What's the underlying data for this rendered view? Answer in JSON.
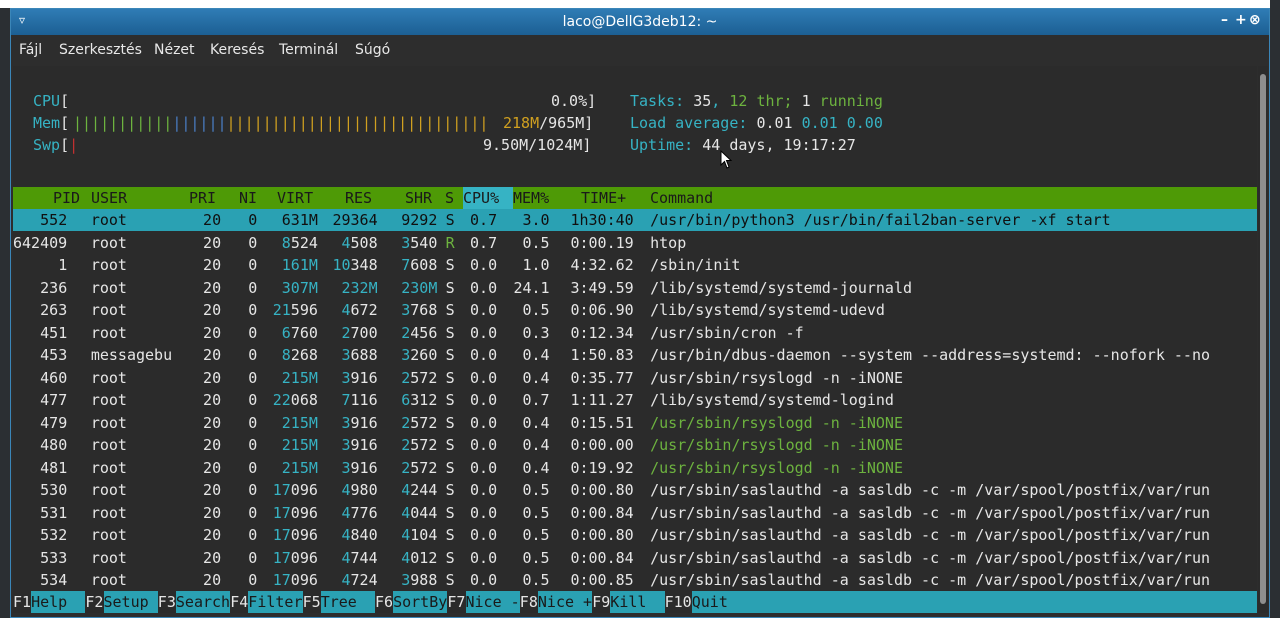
{
  "window": {
    "title": "laco@DellG3deb12: ~",
    "menu_glyph": "▿",
    "ctrl_min": "–",
    "ctrl_max": "+",
    "ctrl_close": "⊗"
  },
  "menu": [
    "Fájl",
    "Szerkesztés",
    "Nézet",
    "Keresés",
    "Terminál",
    "Súgó"
  ],
  "meters": {
    "cpu_label": "CPU",
    "cpu_value": "0.0%]",
    "mem_label": "Mem",
    "mem_used": "218M",
    "mem_total": "/965M]",
    "swp_label": "Swp",
    "swp_value": "9.50M/1024M]"
  },
  "stats": {
    "tasks_label": "Tasks:",
    "tasks": "35",
    "thr": "12",
    "thr_label": "thr;",
    "running": "1",
    "running_label": "running",
    "load_label": "Load average:",
    "load1": "0.01",
    "load5": "0.01",
    "load15": "0.00",
    "uptime_label": "Uptime:",
    "uptime": "44 days, 19:17:27"
  },
  "columns": [
    "PID",
    "USER",
    "PRI",
    "NI",
    "VIRT",
    "RES",
    "SHR",
    "S",
    "CPU%",
    "MEM%",
    "TIME+",
    "Command"
  ],
  "processes": [
    {
      "pid": "552",
      "user": "root",
      "pri": "20",
      "ni": "0",
      "virt": "631M",
      "res": "29364",
      "shr": "9292",
      "s": "S",
      "cpu": "0.7",
      "mem": "3.0",
      "time": "1h30:40",
      "cmd": "/usr/bin/python3 /usr/bin/fail2ban-server -xf start"
    },
    {
      "pid": "642409",
      "user": "root",
      "pri": "20",
      "ni": "0",
      "virt": "8524",
      "res": "4508",
      "shr": "3540",
      "s": "R",
      "cpu": "0.7",
      "mem": "0.5",
      "time": "0:00.19",
      "cmd": "htop"
    },
    {
      "pid": "1",
      "user": "root",
      "pri": "20",
      "ni": "0",
      "virt": "161M",
      "res": "10348",
      "shr": "7608",
      "s": "S",
      "cpu": "0.0",
      "mem": "1.0",
      "time": "4:32.62",
      "cmd": "/sbin/init"
    },
    {
      "pid": "236",
      "user": "root",
      "pri": "20",
      "ni": "0",
      "virt": "307M",
      "res": "232M",
      "shr": "230M",
      "s": "S",
      "cpu": "0.0",
      "mem": "24.1",
      "time": "3:49.59",
      "cmd": "/lib/systemd/systemd-journald"
    },
    {
      "pid": "263",
      "user": "root",
      "pri": "20",
      "ni": "0",
      "virt": "21596",
      "res": "4672",
      "shr": "3768",
      "s": "S",
      "cpu": "0.0",
      "mem": "0.5",
      "time": "0:06.90",
      "cmd": "/lib/systemd/systemd-udevd"
    },
    {
      "pid": "451",
      "user": "root",
      "pri": "20",
      "ni": "0",
      "virt": "6760",
      "res": "2700",
      "shr": "2456",
      "s": "S",
      "cpu": "0.0",
      "mem": "0.3",
      "time": "0:12.34",
      "cmd": "/usr/sbin/cron -f"
    },
    {
      "pid": "453",
      "user": "messagebu",
      "pri": "20",
      "ni": "0",
      "virt": "8268",
      "res": "3688",
      "shr": "3260",
      "s": "S",
      "cpu": "0.0",
      "mem": "0.4",
      "time": "1:50.83",
      "cmd": "/usr/bin/dbus-daemon --system --address=systemd: --nofork --no"
    },
    {
      "pid": "460",
      "user": "root",
      "pri": "20",
      "ni": "0",
      "virt": "215M",
      "res": "3916",
      "shr": "2572",
      "s": "S",
      "cpu": "0.0",
      "mem": "0.4",
      "time": "0:35.77",
      "cmd": "/usr/sbin/rsyslogd -n -iNONE"
    },
    {
      "pid": "477",
      "user": "root",
      "pri": "20",
      "ni": "0",
      "virt": "22068",
      "res": "7116",
      "shr": "6312",
      "s": "S",
      "cpu": "0.0",
      "mem": "0.7",
      "time": "1:11.27",
      "cmd": "/lib/systemd/systemd-logind"
    },
    {
      "pid": "479",
      "user": "root",
      "pri": "20",
      "ni": "0",
      "virt": "215M",
      "res": "3916",
      "shr": "2572",
      "s": "S",
      "cpu": "0.0",
      "mem": "0.4",
      "time": "0:15.51",
      "cmd": "/usr/sbin/rsyslogd -n -iNONE",
      "thread": true
    },
    {
      "pid": "480",
      "user": "root",
      "pri": "20",
      "ni": "0",
      "virt": "215M",
      "res": "3916",
      "shr": "2572",
      "s": "S",
      "cpu": "0.0",
      "mem": "0.4",
      "time": "0:00.00",
      "cmd": "/usr/sbin/rsyslogd -n -iNONE",
      "thread": true
    },
    {
      "pid": "481",
      "user": "root",
      "pri": "20",
      "ni": "0",
      "virt": "215M",
      "res": "3916",
      "shr": "2572",
      "s": "S",
      "cpu": "0.0",
      "mem": "0.4",
      "time": "0:19.92",
      "cmd": "/usr/sbin/rsyslogd -n -iNONE",
      "thread": true
    },
    {
      "pid": "530",
      "user": "root",
      "pri": "20",
      "ni": "0",
      "virt": "17096",
      "res": "4980",
      "shr": "4244",
      "s": "S",
      "cpu": "0.0",
      "mem": "0.5",
      "time": "0:00.80",
      "cmd": "/usr/sbin/saslauthd -a sasldb -c -m /var/spool/postfix/var/run"
    },
    {
      "pid": "531",
      "user": "root",
      "pri": "20",
      "ni": "0",
      "virt": "17096",
      "res": "4776",
      "shr": "4044",
      "s": "S",
      "cpu": "0.0",
      "mem": "0.5",
      "time": "0:00.84",
      "cmd": "/usr/sbin/saslauthd -a sasldb -c -m /var/spool/postfix/var/run"
    },
    {
      "pid": "532",
      "user": "root",
      "pri": "20",
      "ni": "0",
      "virt": "17096",
      "res": "4840",
      "shr": "4104",
      "s": "S",
      "cpu": "0.0",
      "mem": "0.5",
      "time": "0:00.80",
      "cmd": "/usr/sbin/saslauthd -a sasldb -c -m /var/spool/postfix/var/run"
    },
    {
      "pid": "533",
      "user": "root",
      "pri": "20",
      "ni": "0",
      "virt": "17096",
      "res": "4744",
      "shr": "4012",
      "s": "S",
      "cpu": "0.0",
      "mem": "0.5",
      "time": "0:00.84",
      "cmd": "/usr/sbin/saslauthd -a sasldb -c -m /var/spool/postfix/var/run"
    },
    {
      "pid": "534",
      "user": "root",
      "pri": "20",
      "ni": "0",
      "virt": "17096",
      "res": "4724",
      "shr": "3988",
      "s": "S",
      "cpu": "0.0",
      "mem": "0.5",
      "time": "0:00.85",
      "cmd": "/usr/sbin/saslauthd -a sasldb -c -m /var/spool/postfix/var/run"
    }
  ],
  "fkeys": [
    {
      "key": "F1",
      "label": "Help  "
    },
    {
      "key": "F2",
      "label": "Setup "
    },
    {
      "key": "F3",
      "label": "Search"
    },
    {
      "key": "F4",
      "label": "Filter"
    },
    {
      "key": "F5",
      "label": "Tree  "
    },
    {
      "key": "F6",
      "label": "SortBy"
    },
    {
      "key": "F7",
      "label": "Nice -"
    },
    {
      "key": "F8",
      "label": "Nice +"
    },
    {
      "key": "F9",
      "label": "Kill  "
    },
    {
      "key": "F10",
      "label": "Quit"
    }
  ],
  "colors": {
    "accent": "#36b3c4",
    "header": "#4e9a06",
    "selection": "#2aa1b3",
    "titlebar": "#1c5f93"
  }
}
